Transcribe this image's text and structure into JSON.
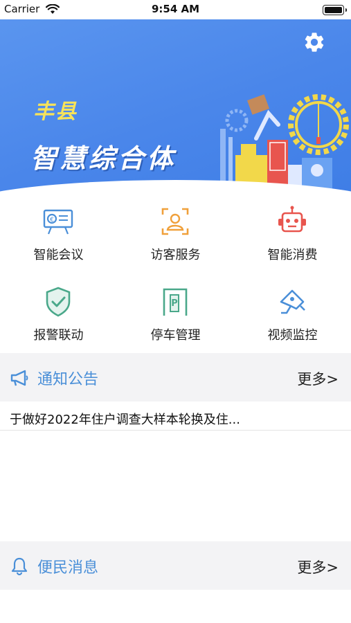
{
  "status_bar": {
    "carrier": "Carrier",
    "time": "9:54 AM"
  },
  "banner": {
    "brand_small": "丰县",
    "brand_big": "智慧综合体",
    "colors": {
      "gradient_start": "#5a95ef",
      "gradient_end": "#3f7ee6",
      "brand_small": "#f7e35a"
    },
    "settings_icon": "gear-icon"
  },
  "grid": {
    "items": [
      {
        "label": "智能会议",
        "icon": "projector-screen-icon",
        "color": "#4a8fd8"
      },
      {
        "label": "访客服务",
        "icon": "visitor-badge-icon",
        "color": "#f0a03a"
      },
      {
        "label": "智能消费",
        "icon": "robot-icon",
        "color": "#e8554e"
      },
      {
        "label": "报警联动",
        "icon": "shield-check-icon",
        "color": "#4aa88a"
      },
      {
        "label": "停车管理",
        "icon": "parking-gate-icon",
        "color": "#4aa88a"
      },
      {
        "label": "视频监控",
        "icon": "camera-icon",
        "color": "#4a8fd8"
      }
    ]
  },
  "notice": {
    "title": "通知公告",
    "more": "更多>",
    "icon": "megaphone-icon",
    "items": [
      {
        "text": "于做好2022年住户调查大样本轮换及住..."
      }
    ]
  },
  "convenience": {
    "title": "便民消息",
    "more": "更多>",
    "icon": "bell-icon"
  }
}
